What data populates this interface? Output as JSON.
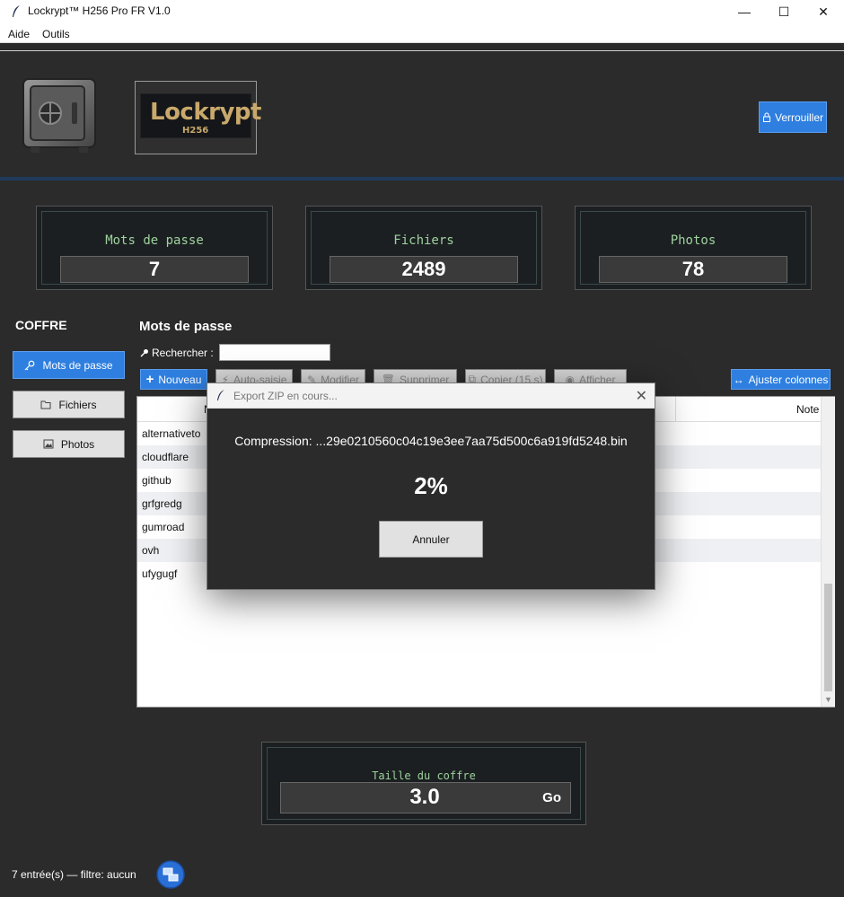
{
  "window": {
    "title": "Lockrypt™ H256 Pro FR V1.0",
    "minimize_glyph": "—",
    "maximize_glyph": "☐",
    "close_glyph": "✕"
  },
  "menu": [
    "Aide",
    "Outils"
  ],
  "header": {
    "logo_text": "Lockrypt",
    "logo_sub": "H256",
    "lock_label": "Verrouiller"
  },
  "stats": [
    {
      "label": "Mots de passe",
      "value": "7"
    },
    {
      "label": "Fichiers",
      "value": "2489"
    },
    {
      "label": "Photos",
      "value": "78"
    }
  ],
  "sidebar": {
    "title": "COFFRE",
    "items": [
      {
        "label": "Mots de passe",
        "icon": "key-icon",
        "active": true
      },
      {
        "label": "Fichiers",
        "icon": "folder-icon",
        "active": false
      },
      {
        "label": "Photos",
        "icon": "image-icon",
        "active": false
      }
    ]
  },
  "main": {
    "title": "Mots de passe",
    "search_label": "Rechercher :",
    "search_value": "",
    "toolbar": {
      "new": "Nouveau",
      "autofill": "Auto-saisie",
      "edit": "Modifier",
      "delete": "Supprimer",
      "copy": "Copier (15 s)",
      "show": "Afficher",
      "fit_columns": "Ajuster colonnes"
    },
    "columns": [
      "N",
      "Note"
    ],
    "rows": [
      "alternativeto",
      "cloudflare",
      "github",
      "grfgredg",
      "gumroad",
      "ovh",
      "ufygugf"
    ]
  },
  "vault": {
    "label": "Taille du coffre",
    "value": "3.0",
    "unit": "Go"
  },
  "status": "7 entrée(s) — filtre: aucun",
  "modal": {
    "title": "Export ZIP en cours...",
    "message": "Compression: ...29e0210560c04c19e3ee7aa75d500c6a919fd5248.bin",
    "percent": "2%",
    "progress": 0.02,
    "cancel": "Annuler"
  },
  "colors": {
    "accent": "#2f7fe0",
    "stat_label": "#9ed29e",
    "background": "#2b2b2b"
  }
}
